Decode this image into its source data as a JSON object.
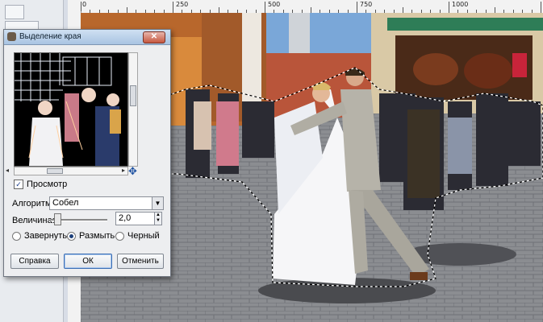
{
  "ruler": {
    "labels": [
      "0",
      "250",
      "500",
      "750",
      "1000"
    ]
  },
  "dialog": {
    "title": "Выделение края",
    "close_label": "✕",
    "preview_checkbox_label": "Просмотр",
    "algorithm": {
      "label": "Алгоритм:",
      "value": "Собел"
    },
    "amount": {
      "label": "Величина:",
      "value": "2,0",
      "slider_fraction": 0.1
    },
    "radios": [
      {
        "label": "Завернуть",
        "selected": false
      },
      {
        "label": "Размыть",
        "selected": true
      },
      {
        "label": "Черный",
        "selected": false
      }
    ],
    "buttons": {
      "help": "Справка",
      "ok": "ОК",
      "cancel": "Отменить"
    }
  },
  "colors": {
    "titlebar": "#b9d1ea",
    "close": "#c6573f",
    "pavement": "#8a8c90",
    "sky": "#7aa7d8"
  }
}
